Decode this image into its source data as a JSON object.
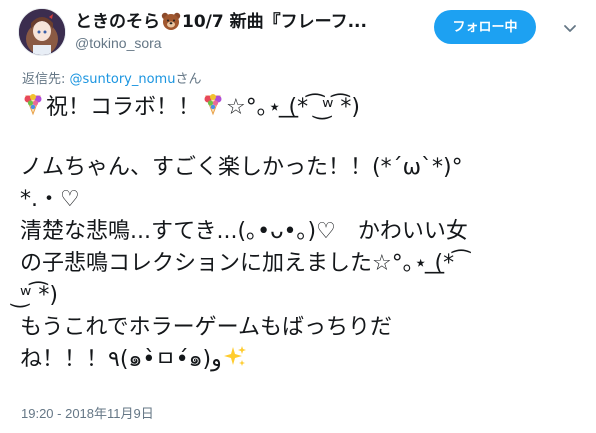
{
  "header": {
    "display_name": "ときのそら",
    "display_name_suffix": "10/7 新曲『フレーフ...",
    "username": "@tokino_sora",
    "follow_label": "フォロー中"
  },
  "reply": {
    "prefix": "返信先: ",
    "handle": "@suntory_nomu",
    "suffix": "さん"
  },
  "tweet": {
    "line1_a": "祝！コラボ！！",
    "line1_b": "☆°｡⋆ ͟(* ͡ ͜ʷ ͡*)",
    "line2": "ノムちゃん、すごく楽しかった！！(*´ω`*)°",
    "line3": "*.・♡",
    "line4": "清楚な悲鳴...すてき...(｡•ᴗ•｡)♡　かわいい女",
    "line5": "の子悲鳴コレクションに加えました☆°｡⋆ ͟(* ͡",
    "line6": "͜ʷ ͡*)",
    "line7": "もうこれでホラーゲームもばっちりだ",
    "line8": "ね！！！٩(๑•̀ㅁ•́๑)و"
  },
  "timestamp": "19:20 - 2018年11月9日",
  "icons": {
    "avatar": "avatar-image",
    "bear": "bear-face-icon",
    "chevron": "chevron-down-icon",
    "flower": "bouquet-emoji-icon",
    "sparkles": "sparkles-emoji-icon"
  },
  "colors": {
    "accent": "#1da1f2",
    "link": "#1b95e0",
    "muted": "#657786",
    "text": "#14171a"
  }
}
